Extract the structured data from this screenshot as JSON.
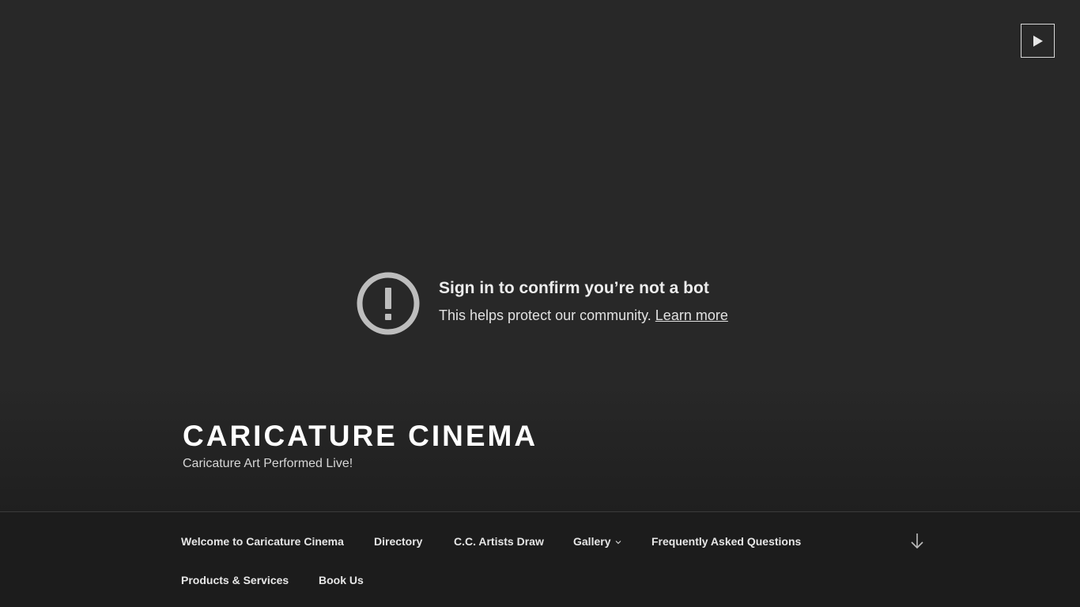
{
  "video": {
    "play_icon": "play-icon",
    "notice": {
      "icon": "exclamation-circle-icon",
      "title": "Sign in to confirm you’re not a bot",
      "body": "This helps protect our community.",
      "link": "Learn more"
    }
  },
  "site": {
    "title": "Caricature Cinema",
    "tagline": "Caricature Art Performed Live!"
  },
  "nav": {
    "items": [
      {
        "label": "Welcome to Caricature Cinema"
      },
      {
        "label": "Directory"
      },
      {
        "label": "C.C. Artists Draw"
      },
      {
        "label": "Gallery",
        "icon": "chevron-down-icon"
      },
      {
        "label": "Frequently Asked Questions"
      },
      {
        "label": "Products & Services"
      },
      {
        "label": "Book Us"
      }
    ],
    "scroll_icon": "arrow-down-icon"
  },
  "colors": {
    "background": "#282828",
    "nav_background": "#1c1c1c",
    "text": "#ffffff"
  }
}
